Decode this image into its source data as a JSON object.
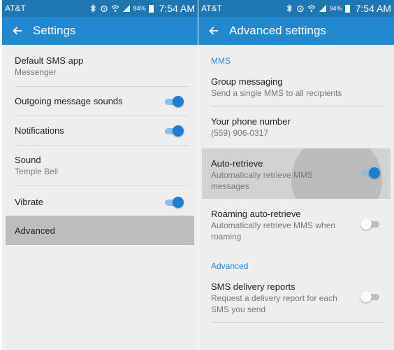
{
  "status_bar": {
    "carrier": "AT&T",
    "battery": "94%",
    "time": "7:54 AM"
  },
  "left": {
    "title": "Settings",
    "items": [
      {
        "title": "Default SMS app",
        "subtitle": "Messenger"
      },
      {
        "title": "Outgoing message sounds",
        "toggle": "on"
      },
      {
        "title": "Notifications",
        "toggle": "on"
      },
      {
        "title": "Sound",
        "subtitle": "Temple Bell"
      },
      {
        "title": "Vibrate",
        "toggle": "on"
      },
      {
        "title": "Advanced",
        "highlighted": true
      }
    ]
  },
  "right": {
    "title": "Advanced settings",
    "sections": {
      "mms": "MMS",
      "advanced": "Advanced"
    },
    "items": [
      {
        "title": "Group messaging",
        "subtitle": "Send a single MMS to all recipients"
      },
      {
        "title": "Your phone number",
        "subtitle": "(559) 906-0317"
      },
      {
        "title": "Auto-retrieve",
        "subtitle": "Automatically retrieve MMS messages",
        "toggle": "on",
        "pressed": true
      },
      {
        "title": "Roaming auto-retrieve",
        "subtitle": "Automatically retrieve MMS when roaming",
        "toggle": "off"
      },
      {
        "title": "SMS delivery reports",
        "subtitle": "Request a delivery report for each SMS you send",
        "toggle": "off"
      }
    ]
  },
  "colors": {
    "status_bar": "#1e77b3",
    "toolbar": "#2288d0",
    "accent": "#2a89cf",
    "toggle_on": "#1e7fd1"
  }
}
